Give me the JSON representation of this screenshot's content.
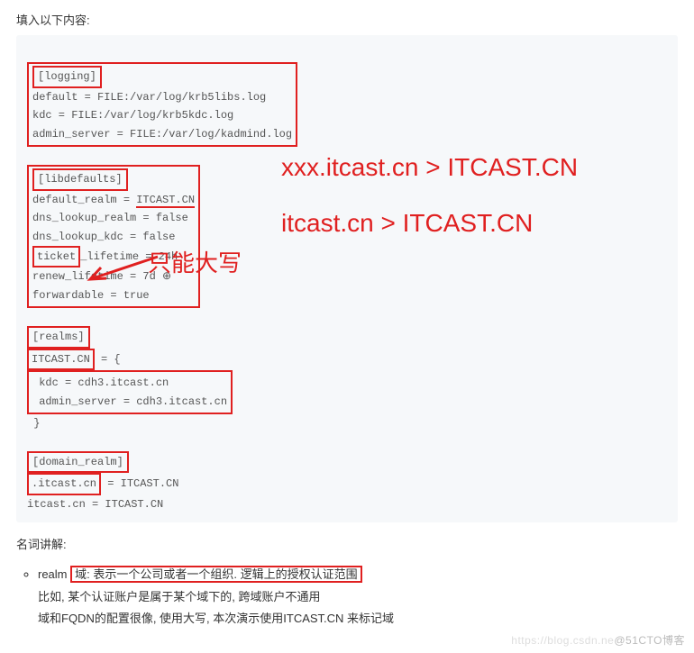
{
  "intro": "填入以下内容:",
  "code": {
    "logging_header": "[logging]",
    "logging_lines": [
      "default = FILE:/var/log/krb5libs.log",
      "kdc = FILE:/var/log/krb5kdc.log",
      "admin_server = FILE:/var/log/kadmind.log"
    ],
    "libdefaults_header": "[libdefaults]",
    "libdefaults_realm_key": "default_realm = ",
    "libdefaults_realm_val": "ITCAST.CN",
    "libdefaults_other": [
      "dns_lookup_realm = false",
      "dns_lookup_kdc = false"
    ],
    "ticket_key": "ticket",
    "ticket_rest": "_lifetime = 24h",
    "libdefaults_tail": [
      "renew_lifetime = 7d",
      "forwardable = true"
    ],
    "cursor": "⊕",
    "realms_header": "[realms]",
    "realms_name": "ITCAST.CN",
    "realms_open": " = {",
    "realms_lines": [
      "kdc = cdh3.itcast.cn",
      "admin_server = cdh3.itcast.cn"
    ],
    "realms_close": "}",
    "domain_realm_header": "[domain_realm]",
    "domain_realm_key": ".itcast.cn",
    "domain_realm_rest": " = ITCAST.CN",
    "domain_realm_line2": "itcast.cn = ITCAST.CN"
  },
  "annot": {
    "map1": "xxx.itcast.cn  > ITCAST.CN",
    "map2": "itcast.cn > ITCAST.CN",
    "upper": "只能大写"
  },
  "term_label": "名词讲解:",
  "glossary": {
    "realm_key": "realm",
    "realm_def1_pre": "域: 表示一个公司或者一个组织. ",
    "realm_def1_hl": "逻辑上的授权认证范围",
    "realm_def2": "比如, 某个认证账户是属于某个域下的, 跨域账户不通用",
    "realm_def3": "域和FQDN的配置很像, 使用大写, 本次演示使用ITCAST.CN 来标记域"
  },
  "watermark": {
    "faint": "https://blog.csdn.ne",
    "main": "@51CTO博客"
  }
}
